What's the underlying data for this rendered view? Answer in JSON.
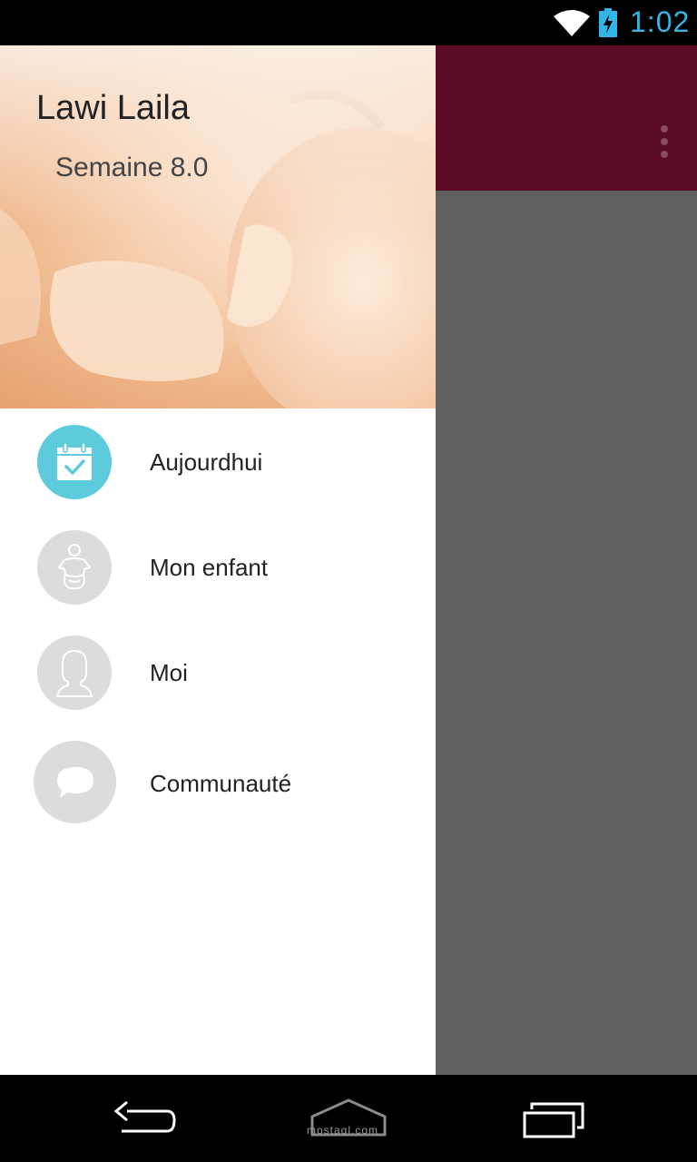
{
  "status_bar": {
    "time": "1:02",
    "time_color": "#33b5e5",
    "icons": [
      "wifi-icon",
      "battery-charging-icon"
    ]
  },
  "toolbar": {
    "color": "#5a0c26",
    "overflow_icon": "more-vert-icon"
  },
  "drawer": {
    "header": {
      "name": "Lawi Laila",
      "subtitle": "Semaine 8.0"
    },
    "items": [
      {
        "label": "Aujourdhui",
        "icon": "calendar-check-icon",
        "active": true
      },
      {
        "label": "Mon enfant",
        "icon": "baby-icon",
        "active": false
      },
      {
        "label": "Moi",
        "icon": "woman-avatar-icon",
        "active": false
      },
      {
        "label": "Communauté",
        "icon": "chat-bubble-icon",
        "active": false
      }
    ],
    "active_color": "#5ecbdd",
    "inactive_color": "#dcdcdc"
  },
  "navigation_bar": {
    "buttons": [
      "back-icon",
      "home-icon",
      "recents-icon"
    ],
    "watermark": "mostaql.com"
  }
}
